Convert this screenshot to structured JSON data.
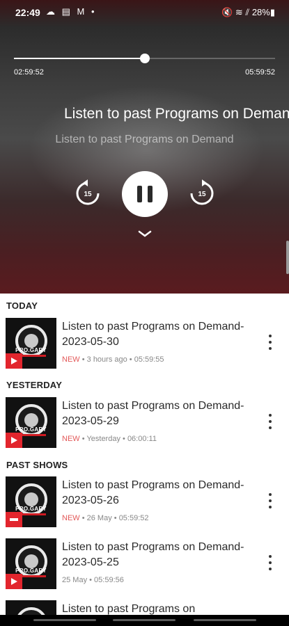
{
  "status_bar": {
    "time": "22:49",
    "left_icons": "☁ ▤ M •",
    "right_icons": "🔇 ≋ ⫽ 28%▮"
  },
  "player": {
    "elapsed": "02:59:52",
    "total": "05:59:52",
    "progress_fraction": 0.5,
    "title": "Listen to past Programs on Demand",
    "subtitle": "Listen to past Programs on Demand",
    "rewind_seconds": "15",
    "forward_seconds": "15",
    "state": "playing"
  },
  "sections": [
    {
      "title": "TODAY"
    },
    {
      "title": "YESTERDAY"
    },
    {
      "title": "PAST SHOWS"
    }
  ],
  "thumbnail_brand": "PRO.GARY",
  "episodes": [
    {
      "title": "Listen to past Programs on Demand-2023-05-30",
      "new": "NEW",
      "date": "3 hours ago",
      "duration": "05:59:55",
      "badge": "play"
    },
    {
      "title": "Listen to past Programs on Demand-2023-05-29",
      "new": "NEW",
      "date": "Yesterday",
      "duration": "06:00:11",
      "badge": "play"
    },
    {
      "title": "Listen to past Programs on Demand-2023-05-26",
      "new": "NEW",
      "date": "26 May",
      "duration": "05:59:52",
      "badge": "playing"
    },
    {
      "title": "Listen to past Programs on Demand-2023-05-25",
      "new": "",
      "date": "25 May",
      "duration": "05:59:56",
      "badge": "play"
    },
    {
      "title": "Listen to past Programs on",
      "new": "",
      "date": "",
      "duration": "",
      "badge": "play"
    }
  ],
  "meta_separator": " • ",
  "colors": {
    "accent_red": "#e2252d",
    "new_label": "#e35a5a"
  }
}
